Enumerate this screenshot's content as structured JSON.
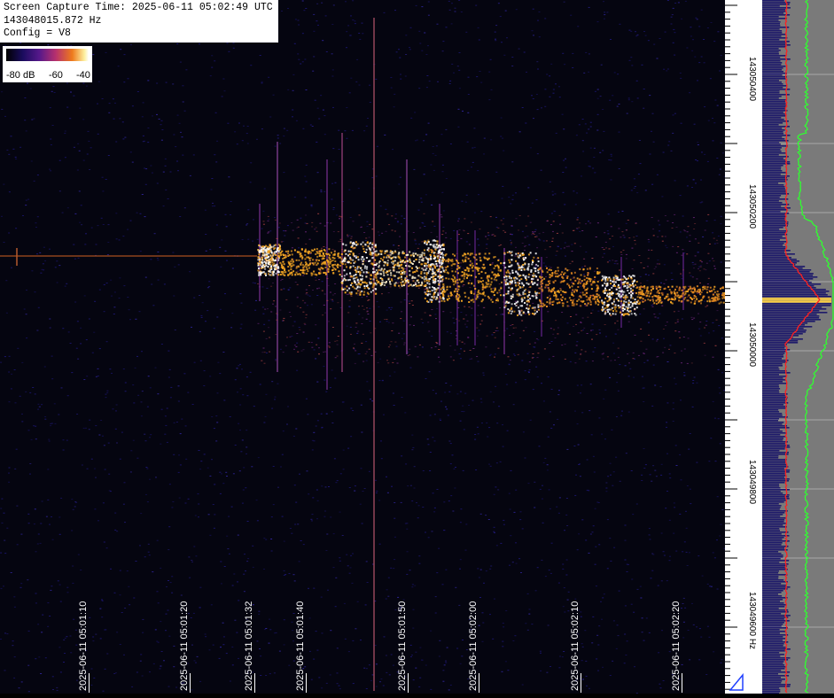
{
  "header": {
    "capture_time": "Screen Capture Time: 2025-06-11 05:02:49 UTC",
    "frequency": "143048015.872 Hz",
    "config": "Config = V8"
  },
  "colorbar": {
    "labels": [
      "-80 dB",
      "-60",
      "-40"
    ]
  },
  "time_axis": {
    "labels": [
      "2025-06-11 05:01:10",
      "2025-06-11 05:01:20",
      "2025-06-11 05:01:32",
      "2025-06-11 05:01:40",
      "2025-06-11 05:01:50",
      "2025-06-11 05:02:00",
      "2025-06-11 05:02:10",
      "2025-06-11 05:02:20"
    ]
  },
  "freq_axis": {
    "labels": [
      "143050400",
      "143050200",
      "143050000",
      "143049800",
      "143049600 Hz"
    ]
  },
  "colors": {
    "background": "#000000",
    "spectrum_bg": "#7a7a7a",
    "noise_blue": "#2a1f8a",
    "mean_trace": "#ff2020",
    "peak_trace": "#30ff30",
    "signal_hot": "#ffffff",
    "signal_warm": "#f5a623"
  },
  "icons": {
    "corner": "triangle-marker-icon"
  }
}
